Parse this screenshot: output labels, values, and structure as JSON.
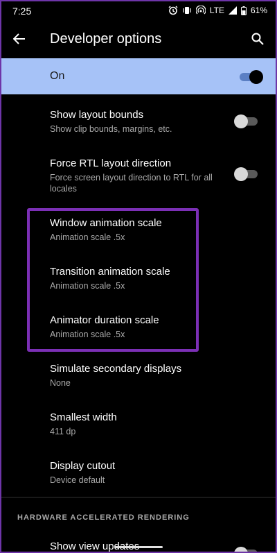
{
  "status": {
    "time": "7:25",
    "network": "LTE",
    "battery": "61%"
  },
  "appbar": {
    "title": "Developer options"
  },
  "master": {
    "label": "On",
    "state": "on"
  },
  "items": [
    {
      "title": "Show layout bounds",
      "subtitle": "Show clip bounds, margins, etc.",
      "toggle": "off"
    },
    {
      "title": "Force RTL layout direction",
      "subtitle": "Force screen layout direction to RTL for all locales",
      "toggle": "off"
    },
    {
      "title": "Window animation scale",
      "subtitle": "Animation scale .5x"
    },
    {
      "title": "Transition animation scale",
      "subtitle": "Animation scale .5x"
    },
    {
      "title": "Animator duration scale",
      "subtitle": "Animation scale .5x"
    },
    {
      "title": "Simulate secondary displays",
      "subtitle": "None"
    },
    {
      "title": "Smallest width",
      "subtitle": "411 dp"
    },
    {
      "title": "Display cutout",
      "subtitle": "Device default"
    }
  ],
  "section": {
    "header": "HARDWARE ACCELERATED RENDERING"
  },
  "partial_item": {
    "title": "Show view updates",
    "toggle": "off"
  },
  "colors": {
    "master_bg": "#a6c2f7",
    "highlight": "#7b2fb5",
    "background": "#000000"
  }
}
